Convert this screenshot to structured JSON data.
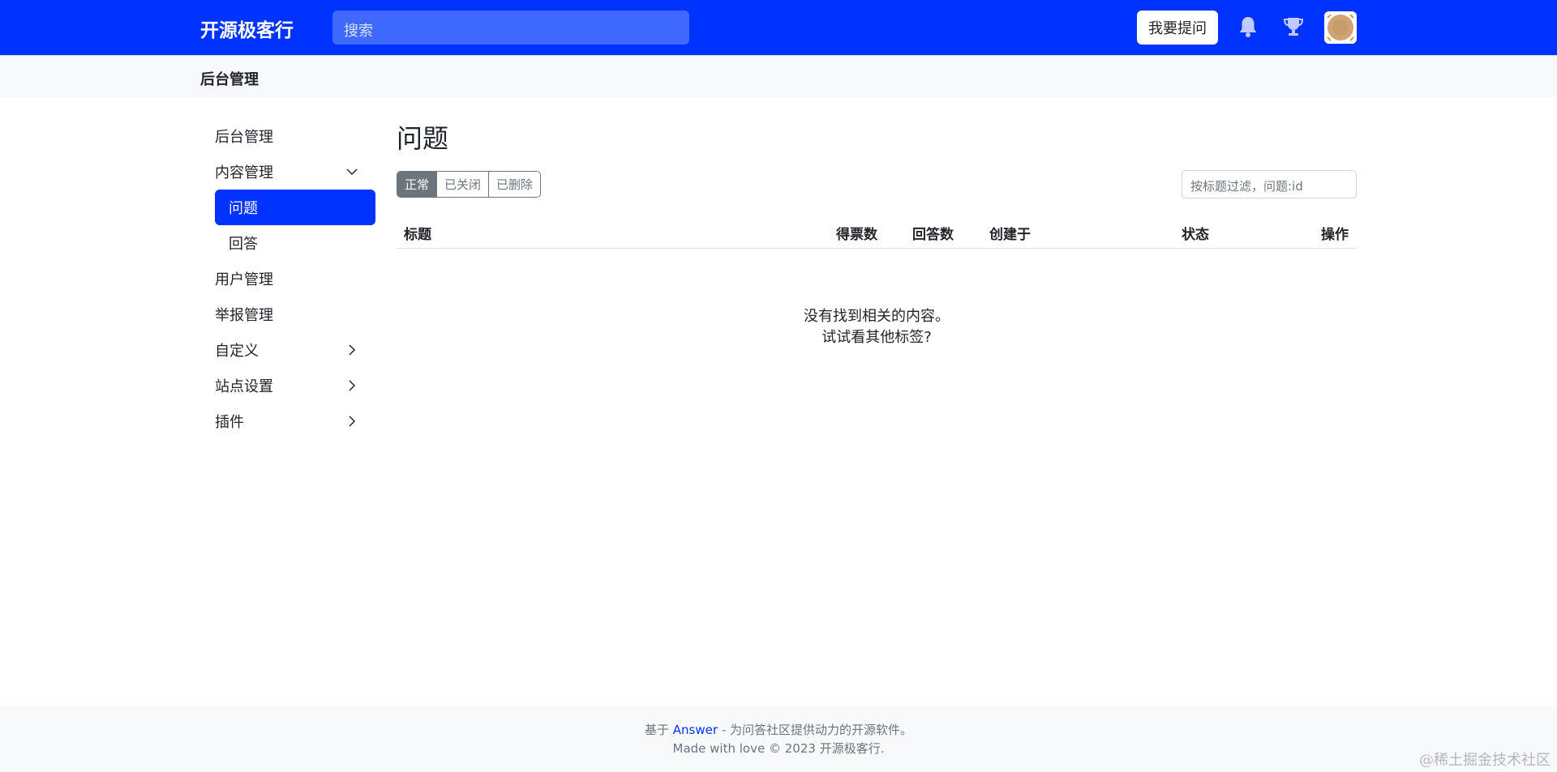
{
  "header": {
    "brand": "开源极客行",
    "search_placeholder": "搜索",
    "ask_button": "我要提问",
    "icons": [
      "bell-icon",
      "trophy-icon",
      "avatar"
    ],
    "brand_color": "#0033ff"
  },
  "subheader": {
    "title": "后台管理"
  },
  "sidebar": {
    "items": [
      {
        "label": "后台管理"
      },
      {
        "label": "内容管理",
        "expanded": true
      },
      {
        "label": "问题",
        "active": true
      },
      {
        "label": "回答"
      },
      {
        "label": "用户管理"
      },
      {
        "label": "举报管理"
      },
      {
        "label": "自定义"
      },
      {
        "label": "站点设置"
      },
      {
        "label": "插件"
      }
    ]
  },
  "main": {
    "title": "问题",
    "tabs": [
      {
        "label": "正常",
        "active": true
      },
      {
        "label": "已关闭"
      },
      {
        "label": "已删除"
      }
    ],
    "filter_placeholder": "按标题过滤，问题:id",
    "table": {
      "headers": [
        "标题",
        "得票数",
        "回答数",
        "创建于",
        "状态",
        "操作"
      ]
    },
    "empty_line1": "没有找到相关的内容。",
    "empty_line2": "试试看其他标签?"
  },
  "footer": {
    "prefix": "基于",
    "link": "Answer",
    "suffix": "- 为问答社区提供动力的开源软件。",
    "line2": "Made with love © 2023 开源极客行."
  },
  "watermark": "@稀土掘金技术社区"
}
